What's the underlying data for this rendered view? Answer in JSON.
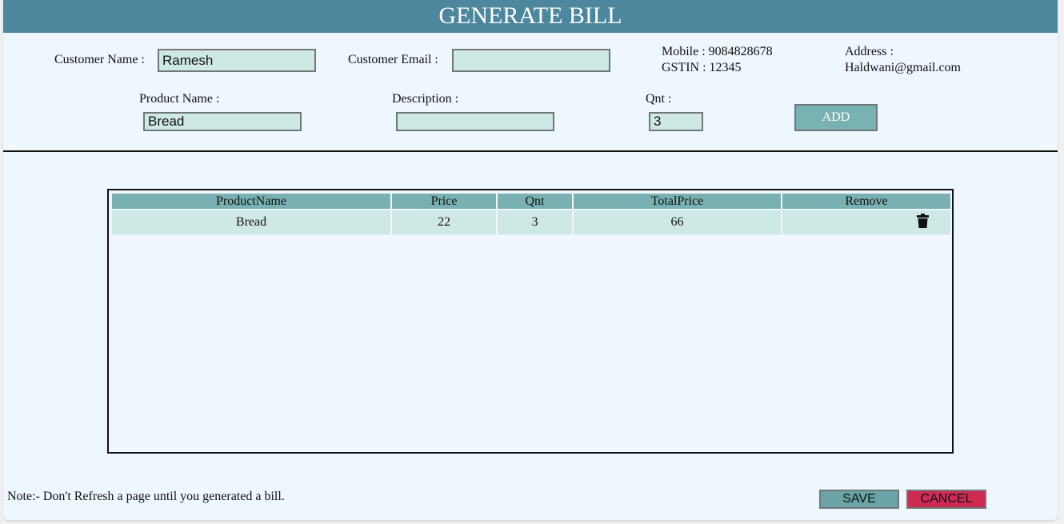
{
  "header": {
    "title": "GENERATE BILL"
  },
  "customer": {
    "name_label": "Customer Name :",
    "name_value": "Ramesh",
    "email_label": "Customer Email :",
    "email_value": ""
  },
  "shop": {
    "mobile": "Mobile : 9084828678",
    "gstin": "GSTIN : 12345",
    "address_label": "Address :",
    "address_value": "Haldwani@gmail.com"
  },
  "product_form": {
    "product_label": "Product Name :",
    "product_value": "Bread",
    "description_label": "Description :",
    "description_value": "",
    "qnt_label": "Qnt :",
    "qnt_value": "3",
    "add_label": "ADD"
  },
  "table": {
    "columns": [
      "ProductName",
      "Price",
      "Qnt",
      "TotalPrice",
      "Remove"
    ],
    "rows": [
      {
        "product": "Bread",
        "price": "22",
        "qnt": "3",
        "total": "66",
        "remove_icon": "trash-icon"
      }
    ]
  },
  "footer": {
    "note": "Note:- Don't Refresh a page until you generated a bill.",
    "save_label": "SAVE",
    "cancel_label": "CANCEL"
  },
  "colors": {
    "header_bg": "#4c879d",
    "table_header_bg": "#79b0b2",
    "row_bg": "#cde8e5",
    "cancel_bg": "#cf2b55",
    "save_bg": "#6aa4a6"
  }
}
